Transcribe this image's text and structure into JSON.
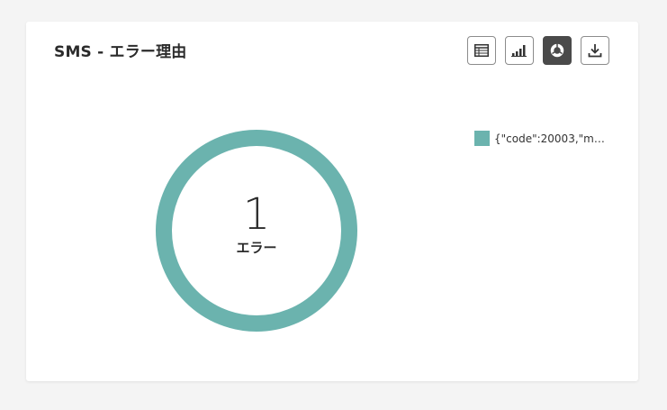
{
  "widget": {
    "title": "SMS - エラー理由"
  },
  "toolbar": {
    "buttons": [
      {
        "name": "table-view-button",
        "icon": "table-icon",
        "active": false
      },
      {
        "name": "bar-view-button",
        "icon": "bar-chart-icon",
        "active": false
      },
      {
        "name": "donut-view-button",
        "icon": "donut-chart-icon",
        "active": true
      },
      {
        "name": "download-button",
        "icon": "download-icon",
        "active": false
      }
    ]
  },
  "colors": {
    "series": "#6bb3ae",
    "active_button": "#4a4a4a",
    "text": "#2b2b2b"
  },
  "chart_data": {
    "type": "pie",
    "variant": "donut",
    "title": "SMS - エラー理由",
    "center_value": "1",
    "center_label": "エラー",
    "slices": [
      {
        "label": "{\"code\":20003,\"mess...",
        "value": 1,
        "color": "#6bb3ae"
      }
    ],
    "legend_position": "right"
  }
}
